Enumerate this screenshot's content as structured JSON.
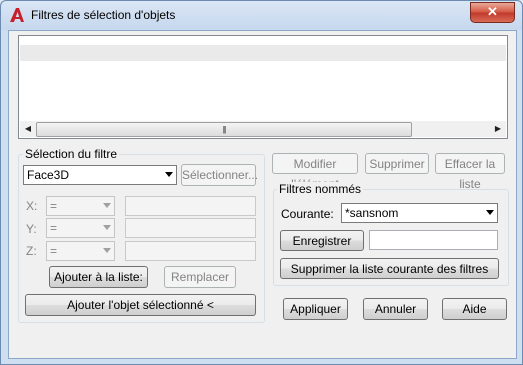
{
  "window": {
    "title": "Filtres de sélection d'objets",
    "close_label": "✕"
  },
  "list": {
    "rows": [
      ""
    ]
  },
  "filter_section": {
    "label": "Sélection du filtre",
    "object_type": "Face3D",
    "select_button": "Sélectionner...",
    "axes": [
      {
        "name": "X:",
        "operator": "="
      },
      {
        "name": "Y:",
        "operator": "="
      },
      {
        "name": "Z:",
        "operator": "="
      }
    ],
    "add_to_list_button": "Ajouter à la liste:",
    "replace_button": "Remplacer",
    "add_selected_button": "Ajouter l'objet sélectionné <"
  },
  "edit_buttons": {
    "modify": "Modifier l'élément",
    "delete": "Supprimer",
    "clear_list": "Effacer la liste"
  },
  "named_filters": {
    "label": "Filtres nommés",
    "current_label": "Courante:",
    "current_value": "*sansnom",
    "save_as_button": "Enregistrer sous:",
    "save_as_value": "",
    "delete_current_button": "Supprimer la liste courante des filtres"
  },
  "footer": {
    "apply": "Appliquer",
    "cancel": "Annuler",
    "help": "Aide"
  }
}
